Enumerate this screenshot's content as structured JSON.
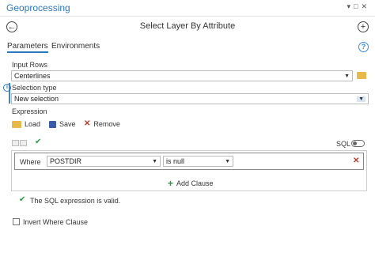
{
  "window": {
    "title": "Geoprocessing",
    "controls": [
      "▾",
      "□",
      "✕"
    ]
  },
  "tool": {
    "title": "Select Layer By Attribute"
  },
  "tabs": [
    {
      "label": "Parameters"
    },
    {
      "label": "Environments"
    }
  ],
  "params": {
    "input_rows_label": "Input Rows",
    "input_rows_value": "Centerlines",
    "selection_type_label": "Selection type",
    "selection_type_value": "New selection",
    "expression_label": "Expression"
  },
  "expr_actions": {
    "load": "Load",
    "save": "Save",
    "remove": "Remove"
  },
  "sql_toggle": {
    "label": "SQL",
    "on": false
  },
  "clause": {
    "where": "Where",
    "field": "POSTDIR",
    "operator": "is null",
    "add_clause": "Add Clause"
  },
  "validation": {
    "message": "The SQL expression is valid."
  },
  "invert": {
    "label": "Invert Where Clause",
    "checked": false
  },
  "colors": {
    "accent": "#2a78c2",
    "valid": "#2b9a3f",
    "remove": "#c23a2a"
  }
}
